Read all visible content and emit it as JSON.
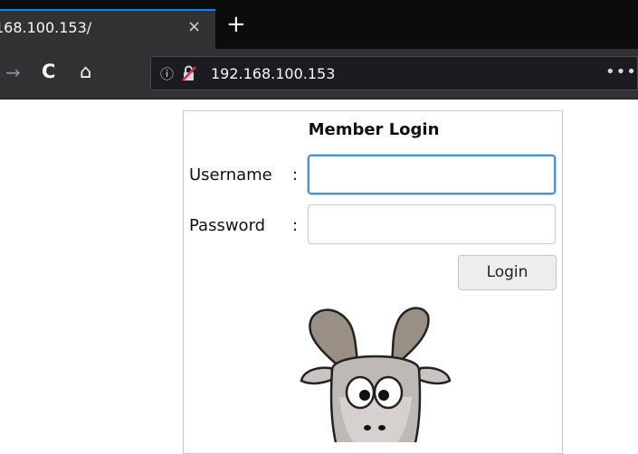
{
  "browser": {
    "tab_title": "168.100.153/",
    "tab_close_glyph": "×",
    "new_tab_glyph": "+",
    "nav_icons": [
      "forward-arrow-icon",
      "reload-icon",
      "home-icon"
    ],
    "nav_glyphs": {
      "forward": "→",
      "reload": "C",
      "home": "⌂"
    },
    "url": "192.168.100.153",
    "info_glyph": "ⓘ",
    "more_glyph": "•••",
    "accent_color": "#0a84ff"
  },
  "login": {
    "title": "Member Login",
    "username_label": "Username",
    "password_label": "Password",
    "colon": ":",
    "username_value": "",
    "password_value": "",
    "button_label": "Login"
  },
  "images": {
    "mascot": "goat-illustration"
  }
}
